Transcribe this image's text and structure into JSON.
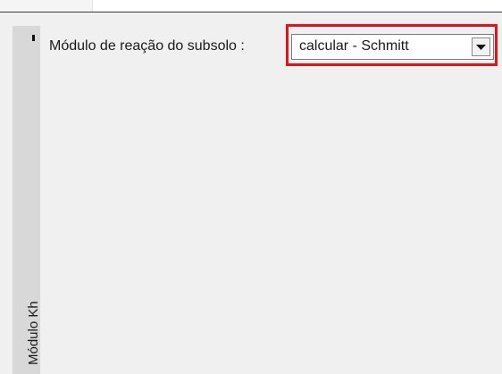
{
  "panel": {
    "vertical_tab_label": "Módulo Kh"
  },
  "field": {
    "label": "Módulo de reação do subsolo :",
    "dropdown_value": "calcular - Schmitt",
    "highlight_color": "#e2141b"
  },
  "icons": {
    "dropdown_arrow": "chevron-down-icon"
  }
}
